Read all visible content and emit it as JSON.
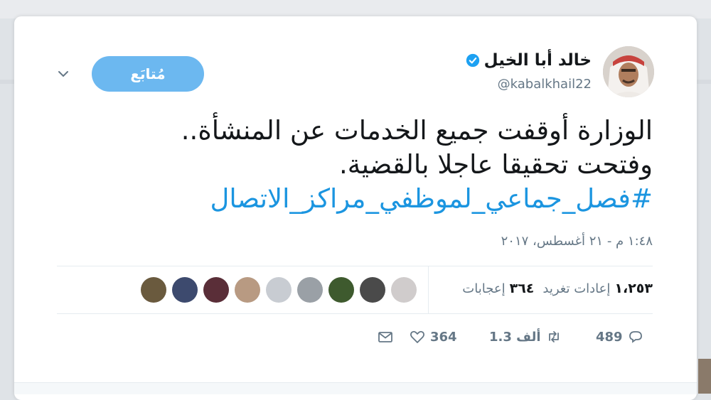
{
  "tweet": {
    "display_name": "خالد أبا الخيل",
    "handle": "@kabalkhail22",
    "follow_label": "مُتابَع",
    "text_lines": [
      "الوزارة أوقفت جميع الخدمات عن المنشأة..",
      "وفتحت تحقيقا عاجلا بالقضية."
    ],
    "hashtag": "#فصل_جماعي_لموظفي_مراكز_الاتصال",
    "timestamp": "١:٤٨ م - ٢١ أغسطس، ٢٠١٧"
  },
  "stats": {
    "retweets_count": "١،٢٥٣",
    "retweets_label": "إعادات تغريد",
    "likes_count": "٣٦٤",
    "likes_label": "إعجابات"
  },
  "actions": {
    "reply_count": "489",
    "retweet_count": "1.3 ألف",
    "like_count": "364"
  },
  "icons": {
    "verified": "verified-badge-icon",
    "caret": "chevron-down-icon",
    "reply": "reply-icon",
    "retweet": "retweet-icon",
    "like": "heart-icon",
    "dm": "envelope-icon"
  },
  "colors": {
    "accent": "#1b95e0",
    "follow_bg": "#6cb8f0",
    "muted": "#657786"
  }
}
